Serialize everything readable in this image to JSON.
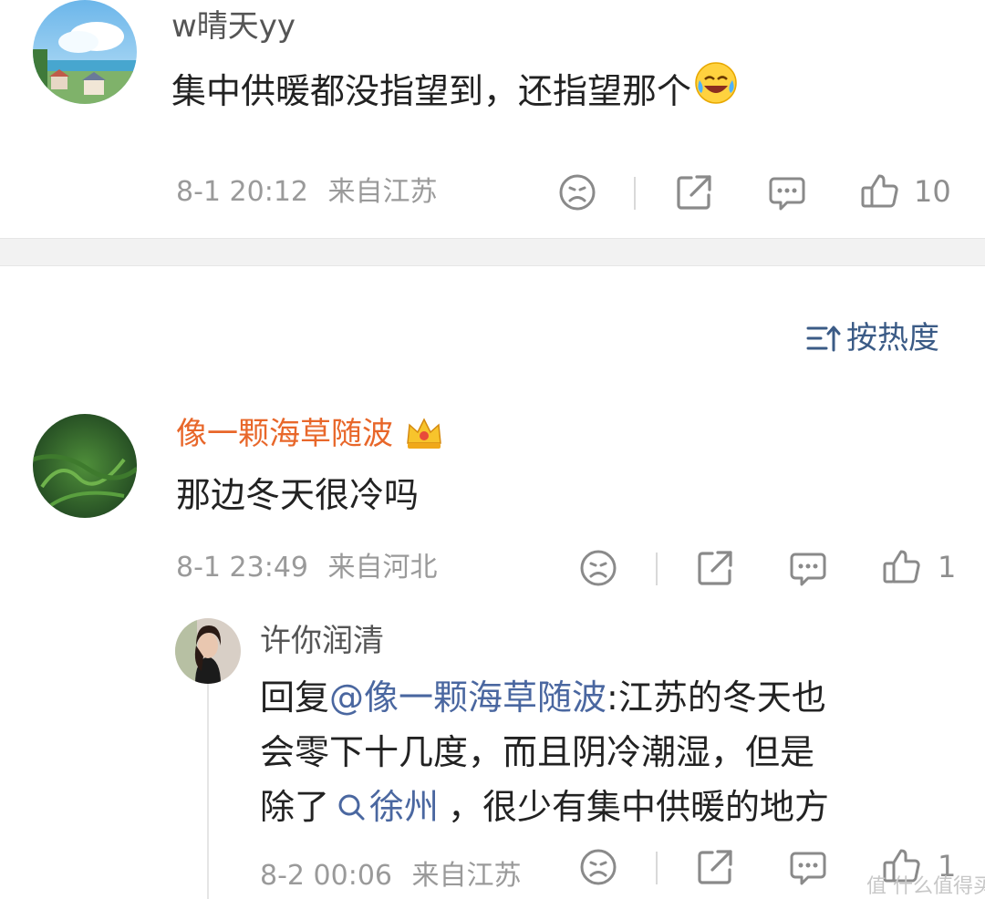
{
  "comments": [
    {
      "username": "w晴天yy",
      "content": "集中供暖都没指望到，还指望那个",
      "time": "8-1 20:12",
      "location": "来自江苏",
      "likes": "10",
      "emoji": "crying-laugh-emoji"
    },
    {
      "username": "像一颗海草随波",
      "content": "那边冬天很冷吗",
      "time": "8-1 23:49",
      "location": "来自河北",
      "likes": "1",
      "badge": "crown-icon"
    }
  ],
  "sort_label": "按热度",
  "reply": {
    "username": "许你润清",
    "prefix": "回复",
    "mention": "@像一颗海草随波",
    "line1_rest": ":江苏的冬天也",
    "line2": "会零下十几度，而且阴冷潮湿，但是",
    "line3_pre": "除了",
    "topic": "徐州",
    "line3_post": "，很少有集中供暖的地方",
    "time": "8-2 00:06",
    "location": "来自江苏",
    "likes": "1"
  },
  "watermark": "值 什么值得买",
  "colors": {
    "vip_name": "#e8672a",
    "link": "#4a67a0",
    "meta": "#9a9a9a"
  }
}
